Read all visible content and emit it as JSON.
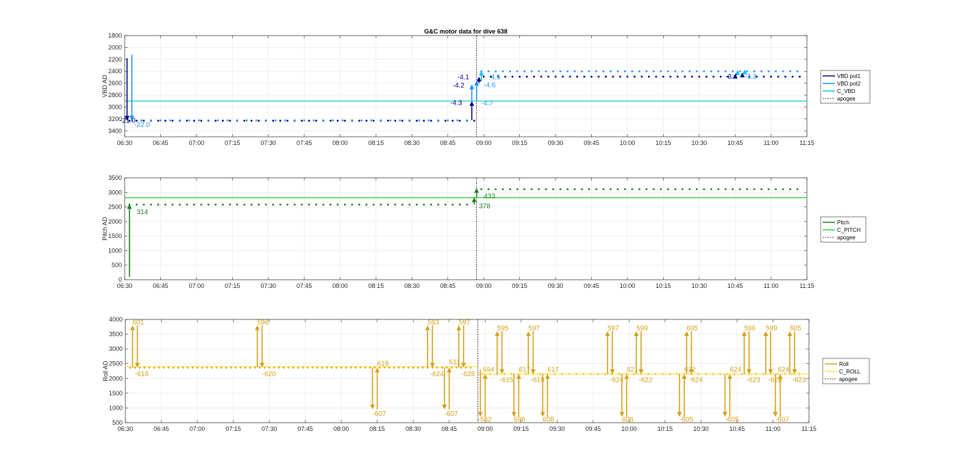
{
  "figure_title": "G&C motor data for dive 638",
  "chart_data": [
    {
      "type": "line",
      "title": "G&C motor data for dive 638",
      "ylabel": "VBD AD",
      "y_reversed": true,
      "ylim": [
        1800,
        3500
      ],
      "yticks": [
        1800,
        2000,
        2200,
        2400,
        2600,
        2800,
        3000,
        3200,
        3400
      ],
      "xlim": [
        "06:30",
        "11:15"
      ],
      "xticks": [
        "06:30",
        "06:45",
        "07:00",
        "07:15",
        "07:30",
        "07:45",
        "08:00",
        "08:15",
        "08:30",
        "08:45",
        "09:00",
        "09:15",
        "09:30",
        "09:45",
        "10:00",
        "10:15",
        "10:30",
        "10:45",
        "11:00",
        "11:15"
      ],
      "grid": true,
      "legend_position": "outside-right",
      "legend": [
        "VBD pot1",
        "VBD pot2",
        "C_VBD",
        "apogee"
      ],
      "apogee": "08:57",
      "series": [
        {
          "name": "VBD pot1",
          "color": "#000080",
          "segments": [
            {
              "x0": "06:32",
              "x1": "08:56",
              "y": 3230,
              "step_min": 3
            },
            {
              "x0": "09:00",
              "x1": "11:12",
              "y": 2490,
              "step_min": 3
            }
          ]
        },
        {
          "name": "VBD pot2",
          "color": "#1e90ff",
          "segments": [
            {
              "x0": "06:33",
              "x1": "08:56",
              "y": 3225,
              "step_min": 4
            },
            {
              "x0": "08:59",
              "x1": "11:12",
              "y": 2400,
              "step_min": 3
            }
          ]
        },
        {
          "name": "C_VBD",
          "color": "#00ced1",
          "const": 2900
        }
      ],
      "arrows": [
        {
          "x": "06:31",
          "y0": 2180,
          "y1": 3230,
          "color": "#000080"
        },
        {
          "x": "06:33",
          "y0": 2120,
          "y1": 3225,
          "color": "#1e90ff"
        },
        {
          "x": "08:55",
          "y0": 3220,
          "y1": 2900,
          "color": "#000080"
        },
        {
          "x": "08:55",
          "y0": 2920,
          "y1": 2620,
          "color": "#1e90ff"
        },
        {
          "x": "08:57",
          "y0": 2880,
          "y1": 2560,
          "color": "#1e90ff"
        },
        {
          "x": "08:58",
          "y0": 2600,
          "y1": 2490,
          "color": "#000080"
        },
        {
          "x": "08:59",
          "y0": 2560,
          "y1": 2390,
          "color": "#00bfff"
        },
        {
          "x": "10:45",
          "y0": 2480,
          "y1": 2440,
          "color": "#000080"
        },
        {
          "x": "10:46",
          "y0": 2420,
          "y1": 2380,
          "color": "#00bfff"
        },
        {
          "x": "10:48",
          "y0": 2450,
          "y1": 2420,
          "color": "#000080"
        },
        {
          "x": "10:49",
          "y0": 2400,
          "y1": 2370,
          "color": "#00bfff"
        }
      ],
      "annotations": [
        {
          "text": "-21.0",
          "x": "06:28",
          "y": 3230,
          "color": "#000080"
        },
        {
          "text": "-22.0",
          "x": "06:34",
          "y": 3300,
          "color": "#1e90ff"
        },
        {
          "text": "-4.1",
          "x": "08:49",
          "y": 2500,
          "color": "#000080"
        },
        {
          "text": "-4.2",
          "x": "08:47",
          "y": 2640,
          "color": "#000080"
        },
        {
          "text": "-4.3",
          "x": "08:46",
          "y": 2930,
          "color": "#000080"
        },
        {
          "text": "-4.5",
          "x": "09:02",
          "y": 2500,
          "color": "#1e90ff"
        },
        {
          "text": "-4.6",
          "x": "09:00",
          "y": 2630,
          "color": "#1e90ff"
        },
        {
          "text": "-4.7",
          "x": "08:59",
          "y": 2940,
          "color": "#1e90ff"
        },
        {
          "text": "-3.4",
          "x": "10:41",
          "y": 2490,
          "color": "#000080"
        },
        {
          "text": "-3.3",
          "x": "10:49",
          "y": 2490,
          "color": "#1e90ff"
        }
      ]
    },
    {
      "type": "line",
      "ylabel": "Pitch AD",
      "ylim": [
        0,
        3500
      ],
      "yticks": [
        0,
        500,
        1000,
        1500,
        2000,
        2500,
        3000,
        3500
      ],
      "xlim": [
        "06:30",
        "11:15"
      ],
      "xticks": [
        "06:30",
        "06:45",
        "07:00",
        "07:15",
        "07:30",
        "07:45",
        "08:00",
        "08:15",
        "08:30",
        "08:45",
        "09:00",
        "09:15",
        "09:30",
        "09:45",
        "10:00",
        "10:15",
        "10:30",
        "10:45",
        "11:00",
        "11:15"
      ],
      "grid": true,
      "legend_position": "outside-right",
      "legend": [
        "Pitch",
        "C_PITCH",
        "apogee"
      ],
      "apogee": "08:57",
      "series": [
        {
          "name": "Pitch",
          "color": "#1a7f1a",
          "segments": [
            {
              "x0": "06:32",
              "x1": "08:55",
              "y": 2580,
              "step_min": 3
            },
            {
              "x0": "08:59",
              "x1": "11:12",
              "y": 3110,
              "step_min": 3
            }
          ]
        },
        {
          "name": "C_PITCH",
          "color": "#32cd32",
          "const": 2820
        }
      ],
      "arrows": [
        {
          "x": "06:32",
          "y0": 100,
          "y1": 2600,
          "color": "#1a7f1a"
        },
        {
          "x": "08:56",
          "y0": 2580,
          "y1": 2830,
          "color": "#1a7f1a"
        },
        {
          "x": "08:57",
          "y0": 2850,
          "y1": 3150,
          "color": "#1a7f1a"
        }
      ],
      "annotations": [
        {
          "text": "314",
          "x": "06:35",
          "y": 2320,
          "color": "#1a7f1a"
        },
        {
          "text": "378",
          "x": "08:58",
          "y": 2520,
          "color": "#1a7f1a"
        },
        {
          "text": "433",
          "x": "09:00",
          "y": 2870,
          "color": "#1a7f1a"
        }
      ]
    },
    {
      "type": "line",
      "ylabel": "Roll AD",
      "ylim": [
        500,
        4000
      ],
      "yticks": [
        500,
        1000,
        1500,
        2000,
        2500,
        3000,
        3500,
        4000
      ],
      "xlim": [
        "06:30",
        "11:15"
      ],
      "xticks": [
        "06:30",
        "06:45",
        "07:00",
        "07:15",
        "07:30",
        "07:45",
        "08:00",
        "08:15",
        "08:30",
        "08:45",
        "09:00",
        "09:15",
        "09:30",
        "09:45",
        "10:00",
        "10:15",
        "10:30",
        "10:45",
        "11:00",
        "11:15"
      ],
      "grid": true,
      "legend_position": "outside-right",
      "legend": [
        "Roll",
        "C_ROLL",
        "apogee"
      ],
      "apogee": "08:57",
      "series": [
        {
          "name": "Roll",
          "color": "#d4a017",
          "segments": [
            {
              "x0": "06:32",
              "x1": "08:55",
              "y": 2370,
              "step_min": 2
            },
            {
              "x0": "08:59",
              "x1": "11:12",
              "y": 2150,
              "step_min": 3
            }
          ]
        },
        {
          "name": "C_ROLL",
          "color": "#ffe24d",
          "segments": [
            {
              "x0": "06:30",
              "x1": "08:57",
              "y": 2400
            },
            {
              "x0": "08:57",
              "x1": "11:15",
              "y": 2150
            }
          ]
        }
      ],
      "arrows": [
        {
          "x": "06:33",
          "y0": 2370,
          "y1": 3800,
          "color": "#d4a017"
        },
        {
          "x": "06:35",
          "y0": 3800,
          "y1": 2370,
          "color": "#d4a017"
        },
        {
          "x": "07:25",
          "y0": 2370,
          "y1": 3800,
          "color": "#d4a017"
        },
        {
          "x": "07:27",
          "y0": 3800,
          "y1": 2370,
          "color": "#d4a017"
        },
        {
          "x": "08:13",
          "y0": 2370,
          "y1": 950,
          "color": "#d4a017"
        },
        {
          "x": "08:15",
          "y0": 950,
          "y1": 2370,
          "color": "#d4a017"
        },
        {
          "x": "08:36",
          "y0": 2370,
          "y1": 3800,
          "color": "#d4a017"
        },
        {
          "x": "08:38",
          "y0": 3800,
          "y1": 2370,
          "color": "#d4a017"
        },
        {
          "x": "08:43",
          "y0": 2370,
          "y1": 950,
          "color": "#d4a017"
        },
        {
          "x": "08:45",
          "y0": 950,
          "y1": 2370,
          "color": "#d4a017"
        },
        {
          "x": "08:49",
          "y0": 2370,
          "y1": 3800,
          "color": "#d4a017"
        },
        {
          "x": "08:51",
          "y0": 3800,
          "y1": 2370,
          "color": "#d4a017"
        },
        {
          "x": "08:58",
          "y0": 2300,
          "y1": 700,
          "color": "#d4a017"
        },
        {
          "x": "09:00",
          "y0": 700,
          "y1": 2150,
          "color": "#d4a017"
        },
        {
          "x": "09:05",
          "y0": 2150,
          "y1": 3600,
          "color": "#d4a017"
        },
        {
          "x": "09:07",
          "y0": 3600,
          "y1": 2150,
          "color": "#d4a017"
        },
        {
          "x": "09:12",
          "y0": 2150,
          "y1": 700,
          "color": "#d4a017"
        },
        {
          "x": "09:14",
          "y0": 700,
          "y1": 2150,
          "color": "#d4a017"
        },
        {
          "x": "09:18",
          "y0": 2150,
          "y1": 3600,
          "color": "#d4a017"
        },
        {
          "x": "09:20",
          "y0": 3600,
          "y1": 2150,
          "color": "#d4a017"
        },
        {
          "x": "09:24",
          "y0": 2150,
          "y1": 700,
          "color": "#d4a017"
        },
        {
          "x": "09:26",
          "y0": 700,
          "y1": 2150,
          "color": "#d4a017"
        },
        {
          "x": "09:51",
          "y0": 2150,
          "y1": 3600,
          "color": "#d4a017"
        },
        {
          "x": "09:53",
          "y0": 3600,
          "y1": 2150,
          "color": "#d4a017"
        },
        {
          "x": "09:57",
          "y0": 2150,
          "y1": 700,
          "color": "#d4a017"
        },
        {
          "x": "09:59",
          "y0": 700,
          "y1": 2150,
          "color": "#d4a017"
        },
        {
          "x": "10:03",
          "y0": 2150,
          "y1": 3600,
          "color": "#d4a017"
        },
        {
          "x": "10:05",
          "y0": 3600,
          "y1": 2150,
          "color": "#d4a017"
        },
        {
          "x": "10:21",
          "y0": 2150,
          "y1": 700,
          "color": "#d4a017"
        },
        {
          "x": "10:23",
          "y0": 700,
          "y1": 2150,
          "color": "#d4a017"
        },
        {
          "x": "10:24",
          "y0": 2150,
          "y1": 3600,
          "color": "#d4a017"
        },
        {
          "x": "10:26",
          "y0": 3600,
          "y1": 2150,
          "color": "#d4a017"
        },
        {
          "x": "10:40",
          "y0": 2150,
          "y1": 700,
          "color": "#d4a017"
        },
        {
          "x": "10:42",
          "y0": 700,
          "y1": 2150,
          "color": "#d4a017"
        },
        {
          "x": "10:48",
          "y0": 2150,
          "y1": 3600,
          "color": "#d4a017"
        },
        {
          "x": "10:50",
          "y0": 3600,
          "y1": 2150,
          "color": "#d4a017"
        },
        {
          "x": "10:57",
          "y0": 2150,
          "y1": 3600,
          "color": "#d4a017"
        },
        {
          "x": "10:59",
          "y0": 3600,
          "y1": 2150,
          "color": "#d4a017"
        },
        {
          "x": "11:01",
          "y0": 2150,
          "y1": 700,
          "color": "#d4a017"
        },
        {
          "x": "11:03",
          "y0": 700,
          "y1": 2150,
          "color": "#d4a017"
        },
        {
          "x": "11:07",
          "y0": 2150,
          "y1": 3600,
          "color": "#d4a017"
        },
        {
          "x": "11:09",
          "y0": 3600,
          "y1": 2150,
          "color": "#d4a017"
        }
      ],
      "annotations": [
        {
          "text": "601",
          "x": "06:33",
          "y": 3900,
          "color": "#d4a017"
        },
        {
          "text": "-616",
          "x": "06:34",
          "y": 2150,
          "color": "#d4a017"
        },
        {
          "text": "596",
          "x": "07:25",
          "y": 3900,
          "color": "#d4a017"
        },
        {
          "text": "-620",
          "x": "07:27",
          "y": 2150,
          "color": "#d4a017"
        },
        {
          "text": "619",
          "x": "08:15",
          "y": 2500,
          "color": "#d4a017"
        },
        {
          "text": "-607",
          "x": "08:13",
          "y": 800,
          "color": "#d4a017"
        },
        {
          "text": "593",
          "x": "08:36",
          "y": 3900,
          "color": "#d4a017"
        },
        {
          "text": "-624",
          "x": "08:37",
          "y": 2150,
          "color": "#d4a017"
        },
        {
          "text": "611",
          "x": "08:45",
          "y": 2550,
          "color": "#d4a017"
        },
        {
          "text": "-607",
          "x": "08:43",
          "y": 800,
          "color": "#d4a017"
        },
        {
          "text": "597",
          "x": "08:49",
          "y": 3900,
          "color": "#d4a017"
        },
        {
          "text": "-628",
          "x": "08:50",
          "y": 2150,
          "color": "#d4a017"
        },
        {
          "text": "594",
          "x": "08:59",
          "y": 2300,
          "color": "#d4a017"
        },
        {
          "text": "-582",
          "x": "08:57",
          "y": 600,
          "color": "#d4a017"
        },
        {
          "text": "595",
          "x": "09:05",
          "y": 3700,
          "color": "#d4a017"
        },
        {
          "text": "-615",
          "x": "09:06",
          "y": 1950,
          "color": "#d4a017"
        },
        {
          "text": "617",
          "x": "09:14",
          "y": 2300,
          "color": "#d4a017"
        },
        {
          "text": "598",
          "x": "09:12",
          "y": 600,
          "color": "#d4a017"
        },
        {
          "text": "597",
          "x": "09:18",
          "y": 3700,
          "color": "#d4a017"
        },
        {
          "text": "-618",
          "x": "09:19",
          "y": 1950,
          "color": "#d4a017"
        },
        {
          "text": "617",
          "x": "09:26",
          "y": 2300,
          "color": "#d4a017"
        },
        {
          "text": "608",
          "x": "09:24",
          "y": 600,
          "color": "#d4a017"
        },
        {
          "text": "597",
          "x": "09:51",
          "y": 3700,
          "color": "#d4a017"
        },
        {
          "text": "-624",
          "x": "09:52",
          "y": 1950,
          "color": "#d4a017"
        },
        {
          "text": "621",
          "x": "09:59",
          "y": 2300,
          "color": "#d4a017"
        },
        {
          "text": "608",
          "x": "09:57",
          "y": 600,
          "color": "#d4a017"
        },
        {
          "text": "599",
          "x": "10:03",
          "y": 3700,
          "color": "#d4a017"
        },
        {
          "text": "-622",
          "x": "10:04",
          "y": 1950,
          "color": "#d4a017"
        },
        {
          "text": "622",
          "x": "10:23",
          "y": 2300,
          "color": "#d4a017"
        },
        {
          "text": "-605",
          "x": "10:21",
          "y": 600,
          "color": "#d4a017"
        },
        {
          "text": "605",
          "x": "10:24",
          "y": 3700,
          "color": "#d4a017"
        },
        {
          "text": "-624",
          "x": "10:25",
          "y": 1950,
          "color": "#d4a017"
        },
        {
          "text": "624",
          "x": "10:42",
          "y": 2300,
          "color": "#d4a017"
        },
        {
          "text": "-605",
          "x": "10:40",
          "y": 600,
          "color": "#d4a017"
        },
        {
          "text": "596",
          "x": "10:48",
          "y": 3700,
          "color": "#d4a017"
        },
        {
          "text": "-623",
          "x": "10:49",
          "y": 1950,
          "color": "#d4a017"
        },
        {
          "text": "599",
          "x": "10:57",
          "y": 3700,
          "color": "#d4a017"
        },
        {
          "text": "-628",
          "x": "10:58",
          "y": 1950,
          "color": "#d4a017"
        },
        {
          "text": "624",
          "x": "11:02",
          "y": 2300,
          "color": "#d4a017"
        },
        {
          "text": "-607",
          "x": "11:01",
          "y": 600,
          "color": "#d4a017"
        },
        {
          "text": "605",
          "x": "11:07",
          "y": 3700,
          "color": "#d4a017"
        },
        {
          "text": "-623",
          "x": "11:08",
          "y": 1950,
          "color": "#d4a017"
        }
      ]
    }
  ]
}
